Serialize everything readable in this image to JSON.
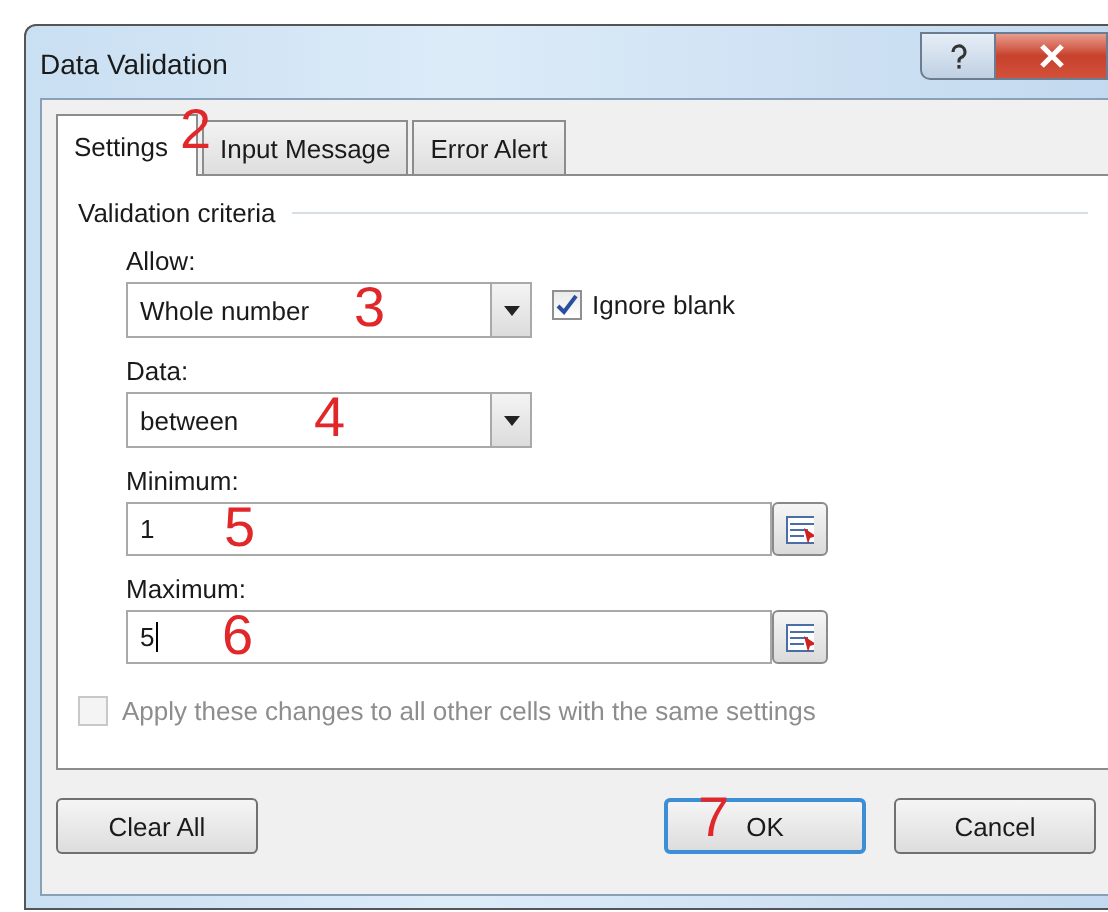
{
  "window": {
    "title": "Data Validation"
  },
  "tabs": [
    {
      "label": "Settings",
      "selected": true,
      "annotation": "2"
    },
    {
      "label": "Input Message",
      "selected": false
    },
    {
      "label": "Error Alert",
      "selected": false
    }
  ],
  "settings": {
    "group_title": "Validation criteria",
    "allow": {
      "label": "Allow:",
      "value": "Whole number",
      "annotation": "3"
    },
    "ignore_blank": {
      "label": "Ignore blank",
      "checked": true
    },
    "data": {
      "label": "Data:",
      "value": "between",
      "annotation": "4"
    },
    "minimum": {
      "label": "Minimum:",
      "value": "1",
      "annotation": "5",
      "focused": false
    },
    "maximum": {
      "label": "Maximum:",
      "value": "5",
      "annotation": "6",
      "focused": true
    },
    "apply_all": {
      "label": "Apply these changes to all other cells with the same settings",
      "checked": false,
      "disabled": true
    }
  },
  "left_buttons": [
    {
      "label": "Clear All",
      "default": false
    }
  ],
  "right_buttons": [
    {
      "label": "OK",
      "default": true,
      "annotation": "7"
    },
    {
      "label": "Cancel",
      "default": false
    }
  ]
}
